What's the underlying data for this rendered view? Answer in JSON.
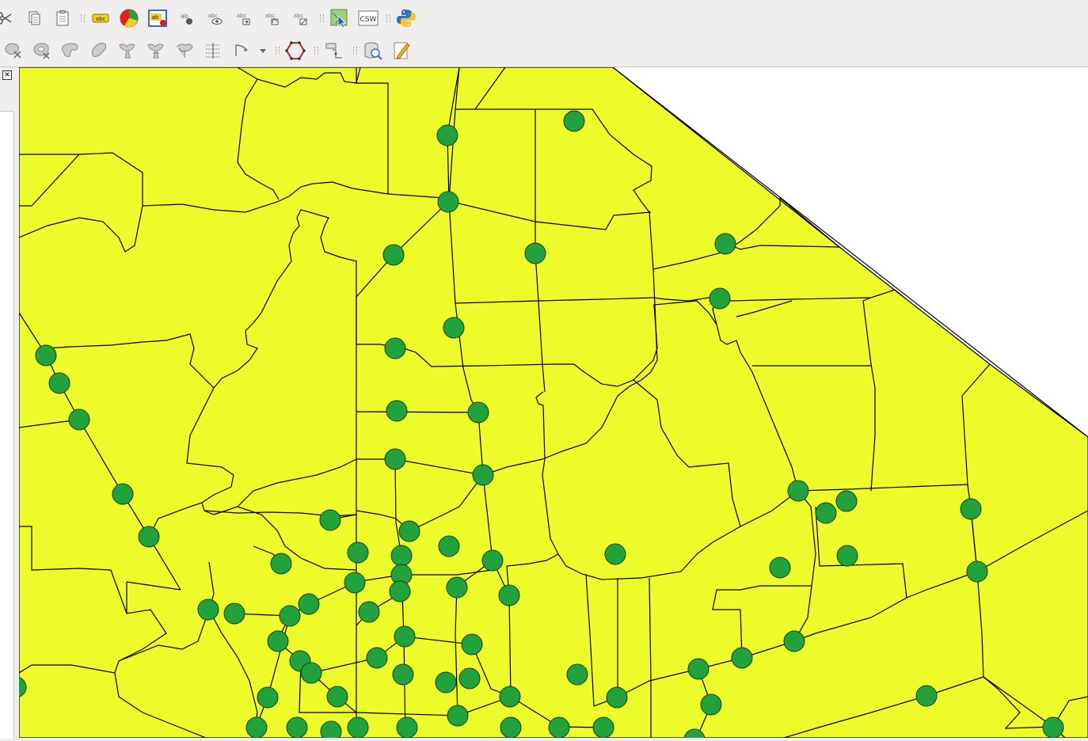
{
  "toolbars": {
    "labels": {
      "items": [
        {
          "name": "cut-features-icon",
          "glyph": "✂"
        },
        {
          "name": "copy-features-icon",
          "glyph": ""
        },
        {
          "name": "paste-features-icon",
          "glyph": ""
        },
        {
          "name": "layer-labeling-icon",
          "text": "abc"
        },
        {
          "name": "layer-diagram-icon",
          "glyph": ""
        },
        {
          "name": "highlight-pinned-labels-icon",
          "text": "ab"
        },
        {
          "name": "pin-labels-icon",
          "text": "ab"
        },
        {
          "name": "show-hide-labels-icon",
          "text": "abc"
        },
        {
          "name": "move-label-icon",
          "text": "abc"
        },
        {
          "name": "rotate-label-icon",
          "text": "abc"
        },
        {
          "name": "change-label-icon",
          "text": "abc"
        },
        {
          "name": "metasearch-icon",
          "glyph": ""
        },
        {
          "name": "csw-icon",
          "text": "CSW"
        },
        {
          "name": "python-console-icon",
          "glyph": ""
        }
      ]
    },
    "digitizing": {
      "items": [
        {
          "name": "simplify-feature-icon"
        },
        {
          "name": "add-ring-icon"
        },
        {
          "name": "add-part-icon"
        },
        {
          "name": "fill-ring-icon"
        },
        {
          "name": "delete-ring-icon"
        },
        {
          "name": "delete-part-icon"
        },
        {
          "name": "reshape-features-icon"
        },
        {
          "name": "offset-curve-icon"
        },
        {
          "name": "rotate-feature-icon"
        },
        {
          "name": "dropdown-arrow-icon"
        },
        {
          "name": "shape-digitize-icon"
        },
        {
          "name": "snapping-tool-icon"
        },
        {
          "name": "db-manager-icon"
        },
        {
          "name": "edit-icon"
        }
      ]
    }
  },
  "colors": {
    "polygon_fill": "#eefb2a",
    "boundary": "#000000",
    "point_fill": "#22a23c",
    "point_stroke": "#163d1a",
    "background": "#ffffff"
  }
}
